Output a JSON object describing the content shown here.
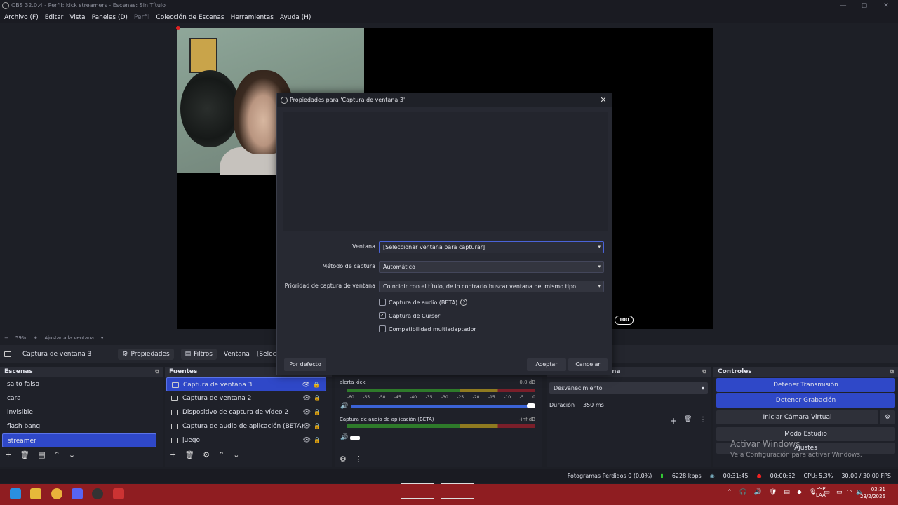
{
  "window": {
    "title": "OBS 32.0.4 - Perfil: kick streamers - Escenas: Sin Título"
  },
  "menu": [
    "Archivo (F)",
    "Editar",
    "Vista",
    "Paneles (D)",
    "Perfil",
    "Colección de Escenas",
    "Herramientas",
    "Ayuda (H)"
  ],
  "preview": {
    "zoom": "59%",
    "fit": "Ajustar a la ventana",
    "badge": "100"
  },
  "context_bar": {
    "source": "Captura de ventana 3",
    "properties": "Propiedades",
    "filters": "Filtros",
    "window_label": "Ventana",
    "window_value": "[Seleccionar ve"
  },
  "scenes": {
    "title": "Escenas",
    "items": [
      "salto falso",
      "cara",
      "invisible",
      "flash bang",
      "streamer"
    ],
    "selected": "streamer"
  },
  "sources": {
    "title": "Fuentes",
    "items": [
      "Captura de ventana 3",
      "Captura de ventana 2",
      "Dispositivo de captura de vídeo 2",
      "Captura de audio de aplicación (BETA)",
      "juego"
    ]
  },
  "mixer": {
    "channels": [
      {
        "name": "alerta kick",
        "db": "0.0 dB",
        "volume_fraction": 1.0
      },
      {
        "name": "Captura de audio de aplicación (BETA)",
        "db": "-inf dB",
        "volume_fraction": 0.0
      }
    ],
    "scale": [
      "-60",
      "-55",
      "-50",
      "-45",
      "-40",
      "-35",
      "-30",
      "-25",
      "-20",
      "-15",
      "-10",
      "-5",
      "0"
    ]
  },
  "transitions": {
    "title_fragment": "na",
    "type": "Desvanecimiento",
    "duration_label": "Duración",
    "duration_value": "350 ms"
  },
  "controls": {
    "title": "Controles",
    "stop_stream": "Detener Transmisión",
    "stop_recording": "Detener Grabación",
    "virtual_cam": "Iniciar Cámara Virtual",
    "studio_mode": "Modo Estudio",
    "settings": "Ajustes"
  },
  "watermark": {
    "line1": "Activar Windows",
    "line2": "Ve a Configuración para activar Windows."
  },
  "status": {
    "dropped": "Fotogramas Perdidos 0 (0.0%)",
    "bitrate": "6228 kbps",
    "stream_time": "00:31:45",
    "rec_time": "00:00:52",
    "cpu": "CPU: 5.3%",
    "fps": "30.00 / 30.00 FPS"
  },
  "taskbar": {
    "lang1": "ESP",
    "lang2": "LAA",
    "time": "03:31",
    "date": "23/2/2026"
  },
  "dialog": {
    "title": "Propiedades para 'Captura de ventana 3'",
    "window_label": "Ventana",
    "window_value": "[Seleccionar ventana para capturar]",
    "method_label": "Método de captura",
    "method_value": "Automático",
    "priority_label": "Prioridad de captura de ventana",
    "priority_value": "Coincidir con el título, de lo contrario buscar ventana del mismo tipo",
    "audio_capture": "Captura de audio (BETA)",
    "audio_checked": false,
    "cursor_capture": "Captura de Cursor",
    "cursor_checked": true,
    "multiadapter": "Compatibilidad multiadaptador",
    "multiadapter_checked": false,
    "defaults": "Por defecto",
    "ok": "Aceptar",
    "cancel": "Cancelar"
  },
  "colors": {
    "accent": "#2f48c8",
    "taskbar": "#8f1d21"
  }
}
